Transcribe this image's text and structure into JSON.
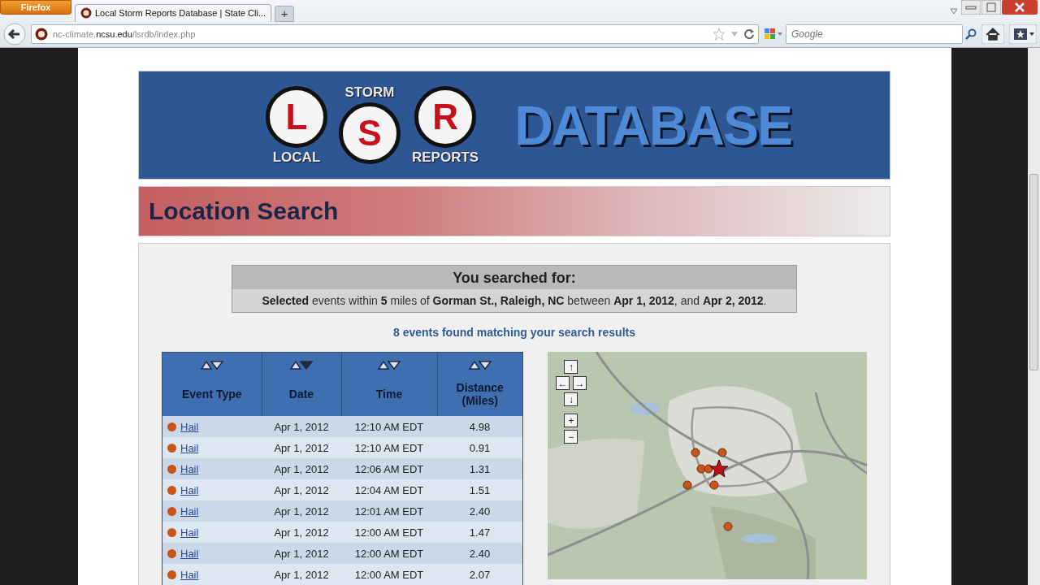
{
  "browser": {
    "menu_button": "Firefox",
    "tabs": [
      {
        "title": "Local Storm Reports Database | State Cli...",
        "selected": true
      }
    ],
    "new_tab": "+",
    "address": {
      "prefix": "nc-climate.",
      "domain": "ncsu.edu",
      "path": "/lsrdb/index.php"
    },
    "search": {
      "placeholder": "Google"
    }
  },
  "banner": {
    "letters": [
      "L",
      "S",
      "R"
    ],
    "words": [
      "LOCAL",
      "STORM",
      "REPORTS"
    ],
    "title": "DATABASE"
  },
  "section_title": "Location Search",
  "summary": {
    "heading": "You searched for:",
    "text": "**Selected** events within **5** miles of **Gorman St., Raleigh, NC** between **Apr 1, 2012**, and **Apr 2, 2012**."
  },
  "result_count": "8 events found matching your search results",
  "table": {
    "columns": [
      {
        "label": "Event Type",
        "sorted": false
      },
      {
        "label": "Date",
        "sorted": true
      },
      {
        "label": "Time",
        "sorted": false
      },
      {
        "label": "Distance (Miles)",
        "sorted": false
      }
    ],
    "rows": [
      {
        "event": "Hail",
        "color": "#c8561a",
        "date": "Apr 1, 2012",
        "time": "12:10 AM EDT",
        "distance": "4.98"
      },
      {
        "event": "Hail",
        "color": "#c8561a",
        "date": "Apr 1, 2012",
        "time": "12:10 AM EDT",
        "distance": "0.91"
      },
      {
        "event": "Hail",
        "color": "#c8561a",
        "date": "Apr 1, 2012",
        "time": "12:06 AM EDT",
        "distance": "1.31"
      },
      {
        "event": "Hail",
        "color": "#c8561a",
        "date": "Apr 1, 2012",
        "time": "12:04 AM EDT",
        "distance": "1.51"
      },
      {
        "event": "Hail",
        "color": "#c8561a",
        "date": "Apr 1, 2012",
        "time": "12:01 AM EDT",
        "distance": "2.40"
      },
      {
        "event": "Hail",
        "color": "#c8561a",
        "date": "Apr 1, 2012",
        "time": "12:00 AM EDT",
        "distance": "1.47"
      },
      {
        "event": "Hail",
        "color": "#c8561a",
        "date": "Apr 1, 2012",
        "time": "12:00 AM EDT",
        "distance": "2.40"
      },
      {
        "event": "Hail",
        "color": "#c8561a",
        "date": "Apr 1, 2012",
        "time": "12:00 AM EDT",
        "distance": "2.07"
      }
    ]
  },
  "map": {
    "kind": "picture",
    "controls": [
      "↑",
      "←",
      "→",
      "↓",
      "+",
      "−"
    ]
  }
}
